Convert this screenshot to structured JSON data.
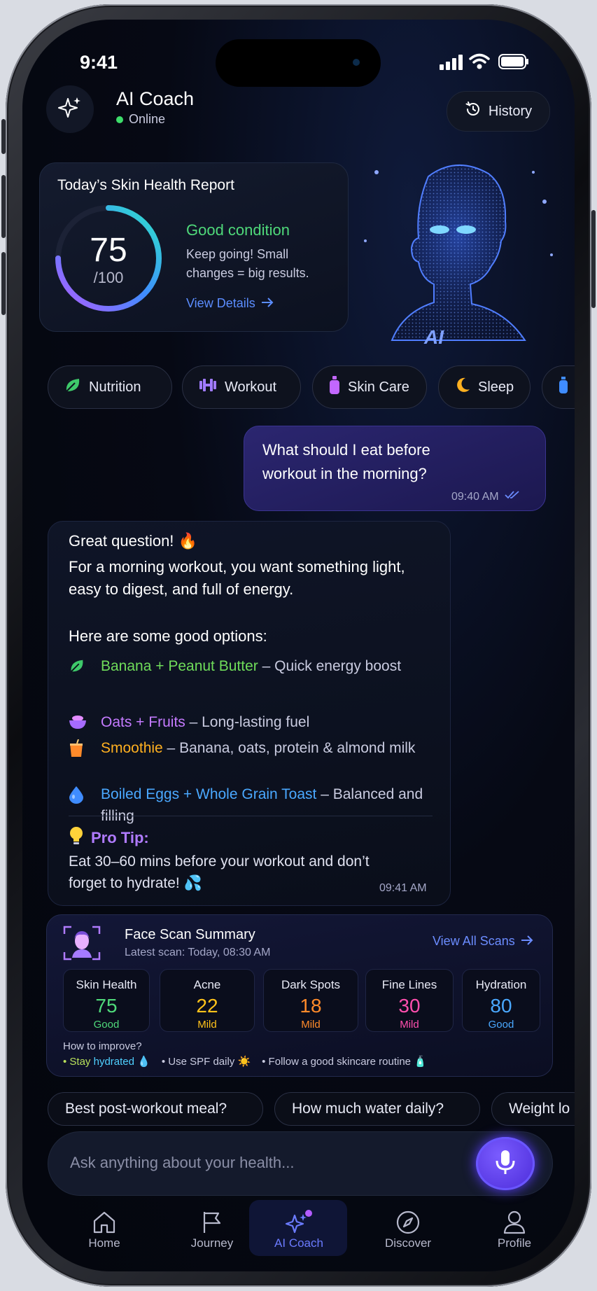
{
  "status_bar": {
    "time": "9:41"
  },
  "header": {
    "title": "AI Coach",
    "status": "Online",
    "history_label": "History"
  },
  "report": {
    "title": "Today’s Skin Health Report",
    "score": "75",
    "score_max": "/100",
    "score_fraction": 0.75,
    "condition": "Good condition",
    "description": "Keep going! Small changes = big results.",
    "link": "View Details",
    "ai_badge": "AI"
  },
  "chips": [
    {
      "label": "Nutrition",
      "icon": "leaf-icon"
    },
    {
      "label": "Workout",
      "icon": "dumbbell-icon"
    },
    {
      "label": "Skin Care",
      "icon": "bottle-icon"
    },
    {
      "label": "Sleep",
      "icon": "moon-icon"
    },
    {
      "label": "",
      "icon": "water-bottle-icon"
    }
  ],
  "user_message": {
    "text": "What should I eat before workout in the morning?",
    "time": "09:40 AM"
  },
  "ai_message": {
    "greeting": "Great question! 🔥",
    "intro": "For a morning workout, you want something light, easy to digest, and full of energy.",
    "options_heading": "Here are some good options:",
    "options": [
      {
        "name": "Banana + Peanut Butter",
        "desc": " – Quick energy boost",
        "color": "#6fdc5a",
        "icon": "leaf-icon"
      },
      {
        "name": "Oats + Fruits",
        "desc": " – Long-lasting fuel",
        "color": "#c57bff",
        "icon": "bowl-icon"
      },
      {
        "name": "Smoothie",
        "desc": " – Banana, oats, protein & almond milk",
        "color": "#ffb020",
        "icon": "cup-icon"
      },
      {
        "name": "Boiled Eggs + Whole Grain Toast",
        "desc": " – Balanced and filling",
        "color": "#4aa8ff",
        "icon": "droplet-icon"
      }
    ],
    "tip_title": "Pro Tip:",
    "tip_text": "Eat 30–60 mins before your workout and don’t forget to hydrate! 💦",
    "time": "09:41 AM"
  },
  "face_scan": {
    "title": "Face Scan Summary",
    "subtitle": "Latest scan: Today, 08:30 AM",
    "link": "View All Scans",
    "metrics": [
      {
        "label": "Skin Health",
        "value": "75",
        "status": "Good",
        "color": "#4fd97a"
      },
      {
        "label": "Acne",
        "value": "22",
        "status": "Mild",
        "color": "#ffc21a"
      },
      {
        "label": "Dark Spots",
        "value": "18",
        "status": "Mild",
        "color": "#ff8a2a"
      },
      {
        "label": "Fine Lines",
        "value": "30",
        "status": "Mild",
        "color": "#ff4fae"
      },
      {
        "label": "Hydration",
        "value": "80",
        "status": "Good",
        "color": "#4aa8ff"
      }
    ],
    "improve_title": "How to improve?",
    "tips": [
      {
        "prefix": "• Stay ",
        "highlight": "hydrated",
        "suffix": " 💧",
        "dot_color": "#4fd97a"
      },
      {
        "prefix": "• Use SPF daily ☀️",
        "highlight": "",
        "suffix": "",
        "dot_color": "#ff4fae"
      },
      {
        "prefix": "• Follow a good skincare routine 🧴",
        "highlight": "",
        "suffix": "",
        "dot_color": "#ff4fae"
      }
    ]
  },
  "suggestions": [
    "Best post-workout meal?",
    "How much water daily?",
    "Weight lo"
  ],
  "input": {
    "placeholder": "Ask anything about your health..."
  },
  "tabs": [
    {
      "label": "Home",
      "icon": "home-icon"
    },
    {
      "label": "Journey",
      "icon": "flag-icon"
    },
    {
      "label": "AI Coach",
      "icon": "sparkle-icon",
      "active": true
    },
    {
      "label": "Discover",
      "icon": "compass-icon"
    },
    {
      "label": "Profile",
      "icon": "user-icon"
    }
  ],
  "colors": {
    "accent": "#6a56ff",
    "online": "#3ddc6a",
    "link": "#5b8dff"
  }
}
